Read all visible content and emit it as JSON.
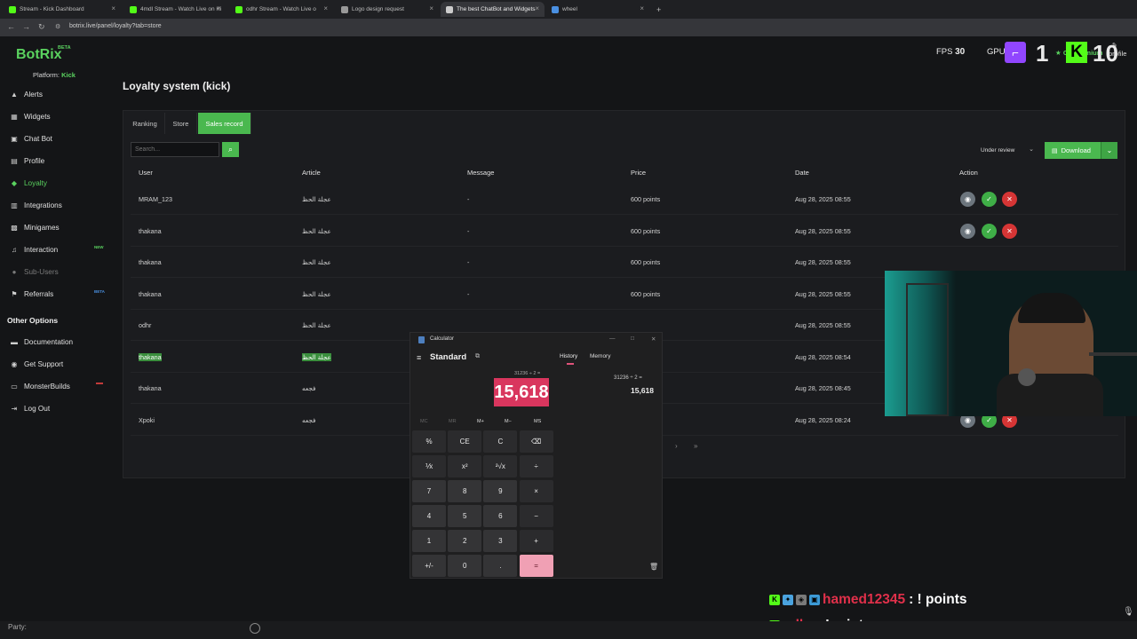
{
  "browser": {
    "tabs": [
      {
        "label": "Stream - Kick Dashboard",
        "color": "#53fc18"
      },
      {
        "label": "4mdl Stream - Watch Live on Ki",
        "color": "#53fc18"
      },
      {
        "label": "odhr Stream - Watch Live o",
        "color": "#53fc18"
      },
      {
        "label": "Logo design request",
        "color": "#999999"
      },
      {
        "label": "The best ChatBot and Widgets",
        "color": "#cccccc"
      },
      {
        "label": "wheel",
        "color": "#4a90e2"
      }
    ],
    "url": "botrix.live/panel/loyalty?tab=store"
  },
  "app": {
    "brand": "BotRix",
    "beta": "BETA",
    "platform_label": "Platform:",
    "platform_value": "Kick",
    "go_premium": "Go Premium",
    "profile": "profile"
  },
  "sidebar": {
    "items": [
      {
        "label": "Alerts",
        "icon": "bell-icon",
        "glyph": "🔔"
      },
      {
        "label": "Widgets",
        "icon": "widgets-icon",
        "glyph": "▦"
      },
      {
        "label": "Chat Bot",
        "icon": "chat-icon",
        "glyph": "▣"
      },
      {
        "label": "Profile",
        "icon": "profile-icon",
        "glyph": "▤"
      },
      {
        "label": "Loyalty",
        "icon": "gem-icon",
        "glyph": "◆"
      },
      {
        "label": "Integrations",
        "icon": "integrations-icon",
        "glyph": "▥"
      },
      {
        "label": "Minigames",
        "icon": "gamepad-icon",
        "glyph": "▩"
      },
      {
        "label": "Interaction",
        "icon": "music-icon",
        "glyph": "♫",
        "badge": "NEW"
      },
      {
        "label": "Sub-Users",
        "icon": "users-icon",
        "glyph": "●"
      },
      {
        "label": "Referrals",
        "icon": "referrals-icon",
        "glyph": "⚑",
        "badge": "BETA"
      }
    ],
    "other_options_title": "Other Options",
    "other_items": [
      {
        "label": "Documentation",
        "icon": "doc-icon",
        "glyph": "▬"
      },
      {
        "label": "Get Support",
        "icon": "support-icon",
        "glyph": "◉"
      },
      {
        "label": "MonsterBuilds",
        "icon": "monitor-icon",
        "glyph": "▭"
      },
      {
        "label": "Log Out",
        "icon": "logout-icon",
        "glyph": "⇥"
      }
    ]
  },
  "main": {
    "title": "Loyalty system (kick)",
    "tabs": [
      "Ranking",
      "Store",
      "Sales record"
    ],
    "search_placeholder": "Search...",
    "status_filter": "Under review",
    "download_label": "Download",
    "columns": [
      "User",
      "Article",
      "Message",
      "Price",
      "Date",
      "Action"
    ],
    "rows": [
      {
        "user": "MRAM_123",
        "article": "عجلة الحظ",
        "message": "-",
        "price": "600 points",
        "date": "Aug 28, 2025 08:55"
      },
      {
        "user": "thakana",
        "article": "عجلة الحظ",
        "message": "-",
        "price": "600 points",
        "date": "Aug 28, 2025 08:55"
      },
      {
        "user": "thakana",
        "article": "عجلة الحظ",
        "message": "-",
        "price": "600 points",
        "date": "Aug 28, 2025 08:55"
      },
      {
        "user": "thakana",
        "article": "عجلة الحظ",
        "message": "-",
        "price": "600 points",
        "date": "Aug 28, 2025 08:55"
      },
      {
        "user": "odhr",
        "article": "عجلة الحظ",
        "message": "",
        "price": "",
        "date": "Aug 28, 2025 08:55"
      },
      {
        "user": "thakana",
        "article": "عجلة الحظ",
        "message": "",
        "price": "",
        "date": "Aug 28, 2025 08:54"
      },
      {
        "user": "thakana",
        "article": "فجعه",
        "message": "",
        "price": "ts",
        "date": "Aug 28, 2025 08:45"
      },
      {
        "user": "Xpoki",
        "article": "فجعه",
        "message": "",
        "price": "ts",
        "date": "Aug 28, 2025 08:24"
      }
    ],
    "pager_next": "›",
    "pager_last": "»"
  },
  "calculator": {
    "title": "Calculator",
    "mode": "Standard",
    "history_tab": "History",
    "memory_tab": "Memory",
    "expression": "31236 ÷ 2 =",
    "display": "15,618",
    "history_expression": "31236  ÷  2 =",
    "history_result": "15,618",
    "memory_keys": [
      "MC",
      "MR",
      "M+",
      "M−",
      "MS"
    ],
    "keys": [
      [
        "%",
        "CE",
        "C",
        "⌫"
      ],
      [
        "⅟x",
        "x²",
        "²√x",
        "÷"
      ],
      [
        "7",
        "8",
        "9",
        "×"
      ],
      [
        "4",
        "5",
        "6",
        "−"
      ],
      [
        "1",
        "2",
        "3",
        "+"
      ],
      [
        "+/-",
        "0",
        ".",
        "="
      ]
    ]
  },
  "overlay": {
    "fps_label": "FPS",
    "fps_value": "30",
    "gpu_label": "GPU",
    "twitch_count": "1",
    "kick_count": "10",
    "chat": [
      {
        "user": "hamed12345",
        "message": ": ! points"
      },
      {
        "user": "odhr",
        "message": ": !points"
      }
    ],
    "party_label": "Party:"
  },
  "colors": {
    "accent": "#4ab84f",
    "danger": "#d63535",
    "calc_accent": "#d9365e"
  }
}
